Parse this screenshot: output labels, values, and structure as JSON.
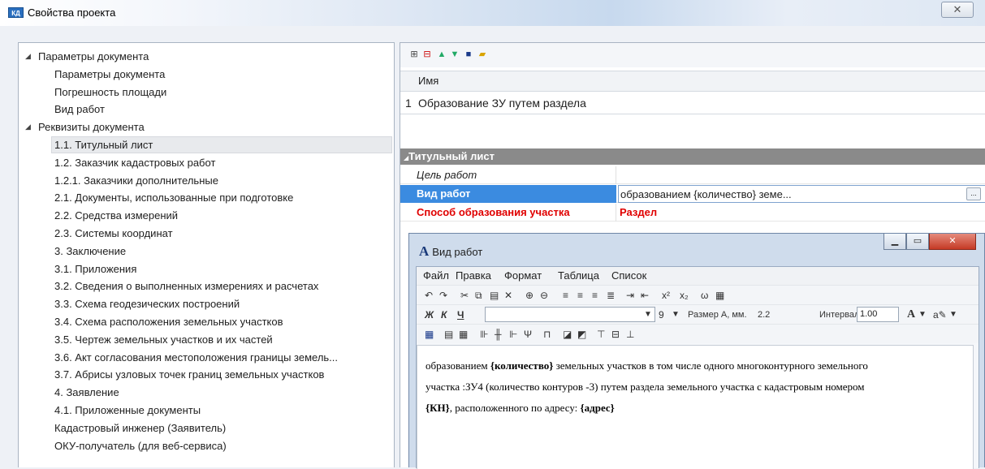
{
  "window": {
    "title": "Свойства проекта",
    "app_icon": "КД",
    "close_label": "✕"
  },
  "tree": [
    {
      "label": "Параметры документа",
      "level": 0,
      "expanded": true
    },
    {
      "label": "Параметры документа",
      "level": 1
    },
    {
      "label": "Погрешность площади",
      "level": 1
    },
    {
      "label": "Вид работ",
      "level": 1
    },
    {
      "label": "Реквизиты документа",
      "level": 0,
      "expanded": true
    },
    {
      "label": "1.1. Титульный лист",
      "level": 1,
      "selected": true
    },
    {
      "label": "1.2. Заказчик кадастровых работ",
      "level": 1
    },
    {
      "label": "1.2.1. Заказчики дополнительные",
      "level": 1
    },
    {
      "label": "2.1. Документы, использованные при подготовке",
      "level": 1
    },
    {
      "label": "2.2. Средства измерений",
      "level": 1
    },
    {
      "label": "2.3. Системы координат",
      "level": 1
    },
    {
      "label": "3. Заключение",
      "level": 1
    },
    {
      "label": "3.1. Приложения",
      "level": 1
    },
    {
      "label": "3.2. Сведения о выполненных измерениях и расчетах",
      "level": 1
    },
    {
      "label": "3.3. Схема геодезических построений",
      "level": 1
    },
    {
      "label": "3.4. Схема расположения земельных участков",
      "level": 1
    },
    {
      "label": "3.5. Чертеж земельных участков и их частей",
      "level": 1
    },
    {
      "label": "3.6. Акт согласования местоположения границы земель...",
      "level": 1
    },
    {
      "label": "3.7. Абрисы узловых точек границ земельных участков",
      "level": 1
    },
    {
      "label": "4. Заявление",
      "level": 1
    },
    {
      "label": "4.1. Приложенные документы",
      "level": 1
    },
    {
      "label": "Кадастровый инженер (Заявитель)",
      "level": 1
    },
    {
      "label": "ОКУ-получатель (для веб-сервиса)",
      "level": 1
    }
  ],
  "grid": {
    "header": "Имя",
    "rows": [
      {
        "num": "1",
        "name": "Образование ЗУ путем раздела"
      }
    ]
  },
  "properties": {
    "section": "Титульный лист",
    "rows": [
      {
        "key": "Цель работ",
        "value": ""
      },
      {
        "key": "Вид работ",
        "value": "образованием {количество} земе...",
        "ellipsis": "..."
      },
      {
        "key": "Способ образования участка",
        "value": "Раздел"
      }
    ]
  },
  "dialog": {
    "title": "Вид работ",
    "icon_letter": "A",
    "menu": [
      "Файл",
      "Правка",
      "Формат",
      "Таблица",
      "Список"
    ],
    "format": {
      "font_size": "9",
      "size_label": "Размер А, мм.",
      "size_value": "2.2",
      "interval_label": "Интервал:",
      "interval_value": "1.00"
    },
    "text": {
      "line1_a": "образованием ",
      "line1_b": "{количество}",
      "line1_c": " земельных участков в том числе одного многоконтурного земельного",
      "line2": "участка :ЗУ4 (количество контуров -3)  путем раздела земельного участка с  кадастровым  номером",
      "line3_a": "{КН}",
      "line3_b": ", расположенного по адресу: ",
      "line3_c": "{адрес}"
    }
  }
}
